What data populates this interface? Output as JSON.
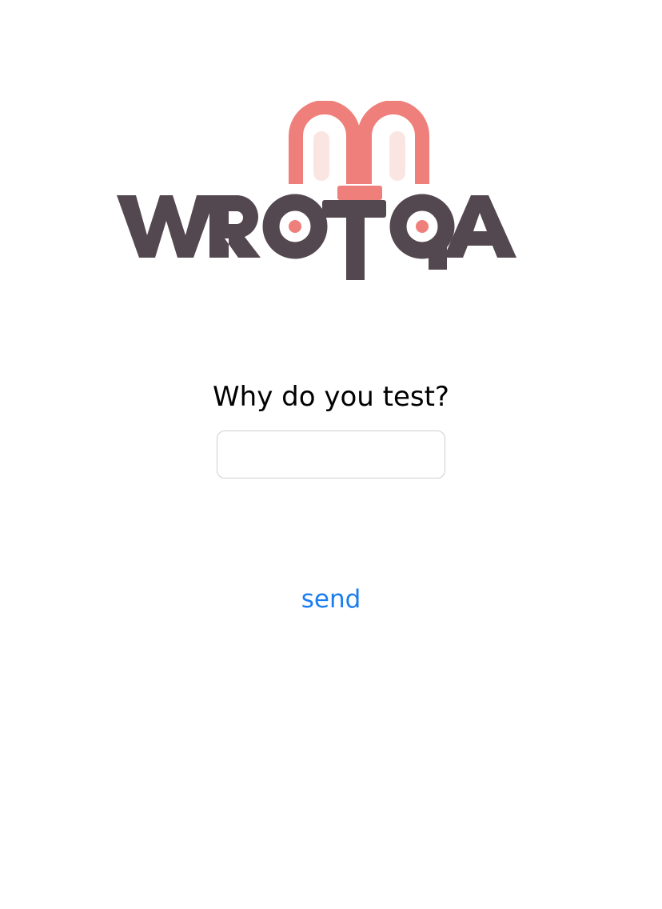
{
  "logo": {
    "wordmark": "WROTQA",
    "colors": {
      "letters": "#544850",
      "ears": "#ef7f7a",
      "ears_inner": "#fbe5e2",
      "dots": "#ef7f7a"
    }
  },
  "form": {
    "question": "Why do you test?",
    "answer_value": "",
    "answer_placeholder": "",
    "send_label": "send",
    "accent_color": "#1a7ef0"
  }
}
